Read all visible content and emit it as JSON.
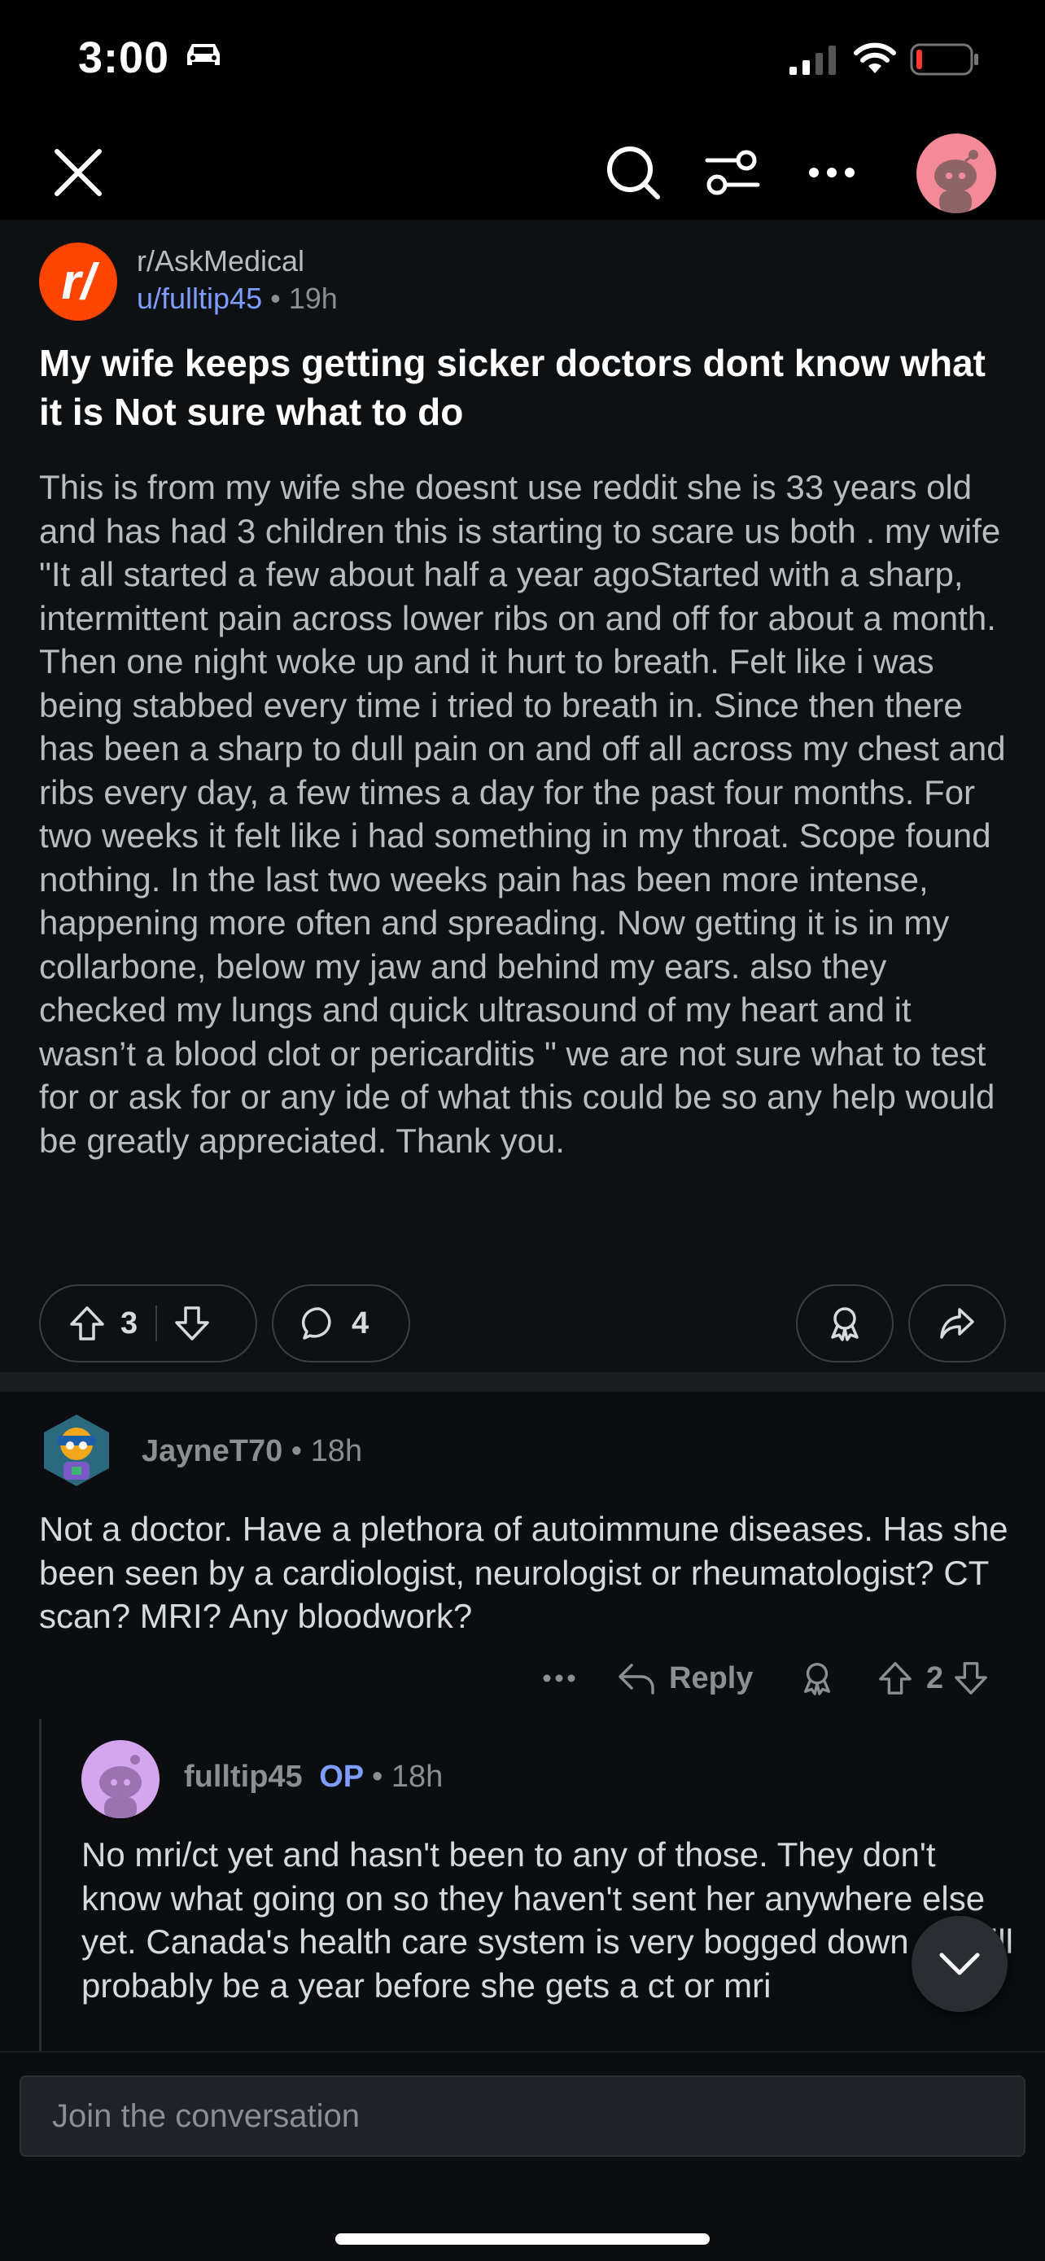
{
  "status": {
    "time": "3:00"
  },
  "post": {
    "subreddit": "r/AskMedical",
    "author": "u/fulltip45",
    "age": "19h",
    "title": "My wife keeps getting sicker doctors dont know what it is Not sure what to do",
    "body": "This is from my wife she doesnt use reddit she is 33 years old and has had 3 children this is starting to scare us both .  my wife \"It all started a few about half a year agoStarted with a sharp, intermittent pain across lower ribs on and off for about a month. Then one night woke up and it hurt to breath. Felt like i was being stabbed every time i tried to breath in. Since then there has been a sharp to dull pain on and off all across my chest and ribs every day, a few times a day for the past four months. For two weeks it felt like i had something in my throat. Scope found nothing. In the last two weeks pain has been more intense, happening more often and spreading. Now getting it is in my collarbone, below my jaw and behind my ears. also they checked my lungs and quick ultrasound of my heart and it wasn’t a blood clot or pericarditis \" we are not sure what to test for or ask for or any ide of what this could be so any help would be greatly appreciated. Thank you.",
    "votes": "3",
    "comments": "4"
  },
  "comment": {
    "author": "JayneT70",
    "age": "18h",
    "body": "Not a doctor. Have a plethora of autoimmune diseases. Has she been seen by a cardiologist, neurologist or rheumatologist? CT scan? MRI? Any bloodwork?",
    "reply_label": "Reply",
    "votes": "2"
  },
  "reply": {
    "author": "fulltip45",
    "op_badge": "OP",
    "age": "18h",
    "body": "No mri/ct yet and hasn't been to any of those. They don't know what going on so they haven't sent her anywhere else yet.  Canada's health care system is very bogged down . It will probably be a year before she gets a ct or mri"
  },
  "composer": {
    "placeholder": "Join the conversation"
  },
  "colors": {
    "background": "#0b0d10",
    "accent": "#ff4500",
    "link": "#7f9cff"
  }
}
